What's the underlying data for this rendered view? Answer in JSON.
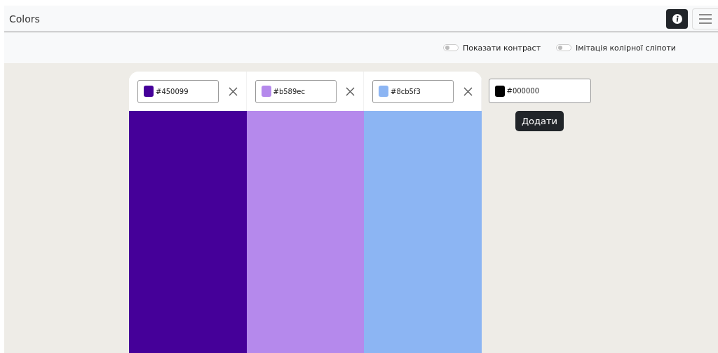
{
  "navbar": {
    "title": "Colors"
  },
  "toggles": [
    {
      "label": "Показати контраст",
      "on": false
    },
    {
      "label": "Імітація колірної сліпоти",
      "on": false
    }
  ],
  "palette": [
    {
      "hex": "#450099",
      "color": "#450099"
    },
    {
      "hex": "#b589ec",
      "color": "#b589ec"
    },
    {
      "hex": "#8cb5f3",
      "color": "#8cb5f3"
    }
  ],
  "new_color": {
    "hex": "#000000",
    "color": "#000000",
    "button": "Додати"
  }
}
